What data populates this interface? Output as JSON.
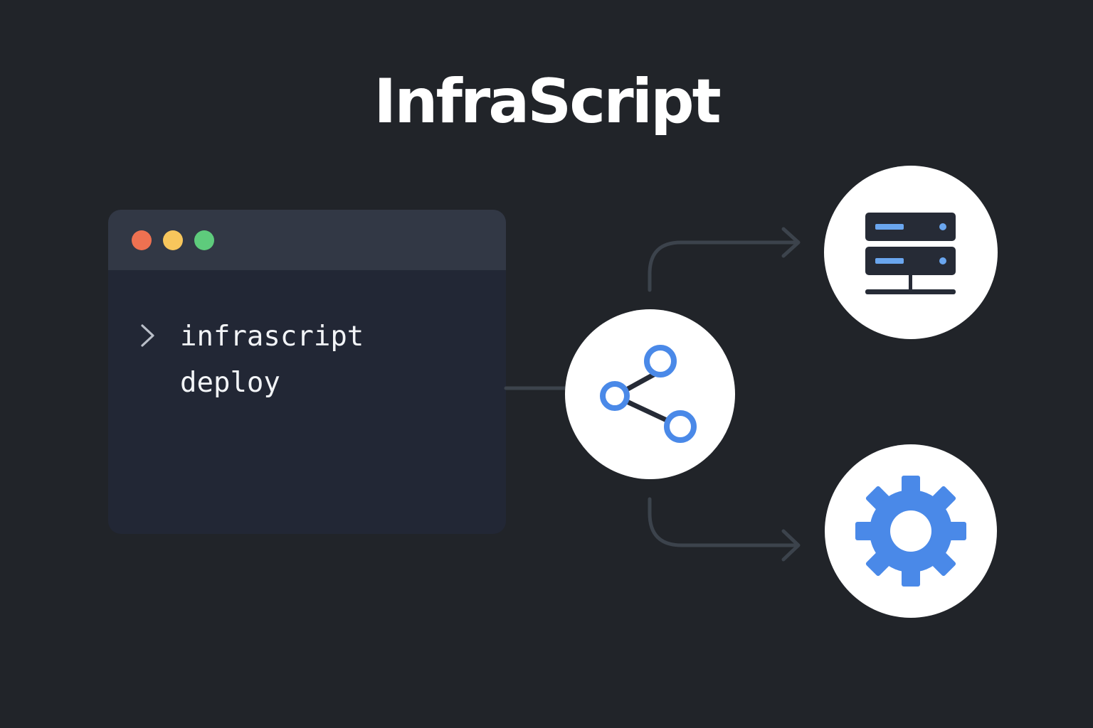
{
  "title": "InfraScript",
  "terminal": {
    "window_dots": [
      "red",
      "yellow",
      "green"
    ],
    "prompt_icon": "chevron-right-icon",
    "command_lines": [
      "infrascript",
      "deploy"
    ]
  },
  "nodes": {
    "center": {
      "icon": "share-icon"
    },
    "top_target": {
      "icon": "server-icon"
    },
    "bottom_target": {
      "icon": "gear-icon"
    }
  },
  "colors": {
    "background": "#212429",
    "terminal_body": "#222735",
    "terminal_header": "#323845",
    "dot_red": "#ee7151",
    "dot_yellow": "#f7c65c",
    "dot_green": "#5ecb7c",
    "accent_blue": "#4a89e8",
    "icon_dark": "#262b36",
    "connector": "#3c434c",
    "node_fill": "#ffffff"
  }
}
